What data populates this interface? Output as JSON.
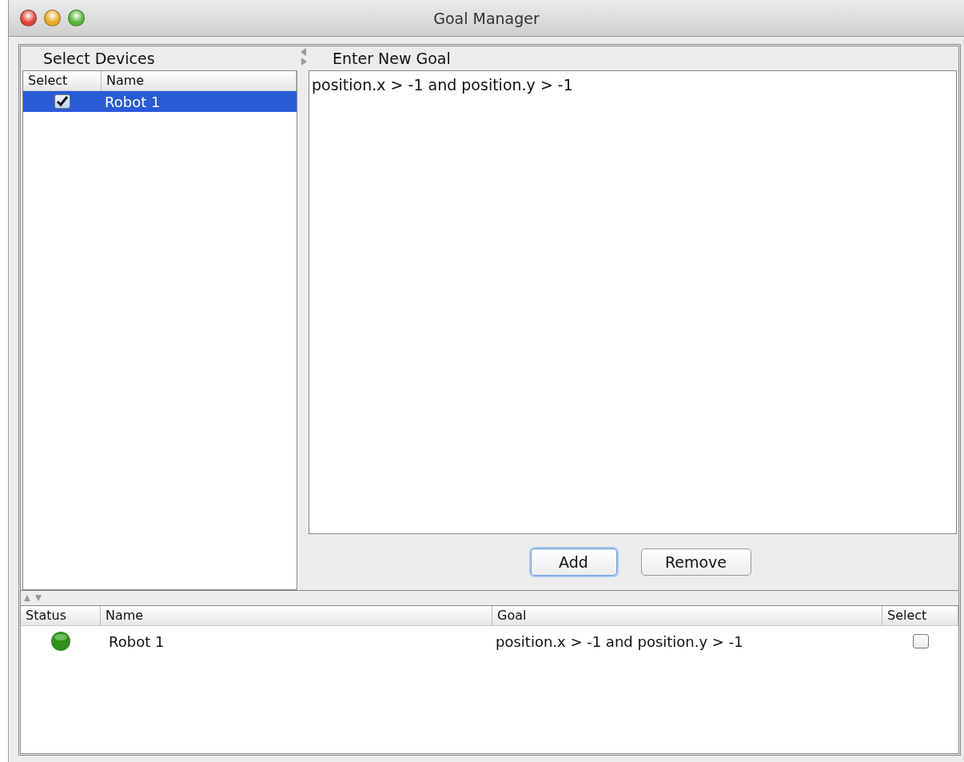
{
  "window": {
    "title": "Goal Manager"
  },
  "devices": {
    "title": "Select Devices",
    "columns": [
      "Select",
      "Name"
    ],
    "rows": [
      {
        "checked": true,
        "selected": true,
        "name": "Robot 1"
      }
    ]
  },
  "goal_editor": {
    "title": "Enter New Goal",
    "value": "position.x > -1 and position.y > -1"
  },
  "buttons": [
    {
      "label": "Add",
      "focused": true
    },
    {
      "label": "Remove",
      "focused": false
    }
  ],
  "goals": {
    "columns": [
      "Status",
      "Name",
      "Goal",
      "Select"
    ],
    "rows": [
      {
        "color": "#2f8f1c",
        "name": "Robot 1",
        "goal": "position.x > -1 and position.y > -1",
        "checked": false
      }
    ]
  }
}
